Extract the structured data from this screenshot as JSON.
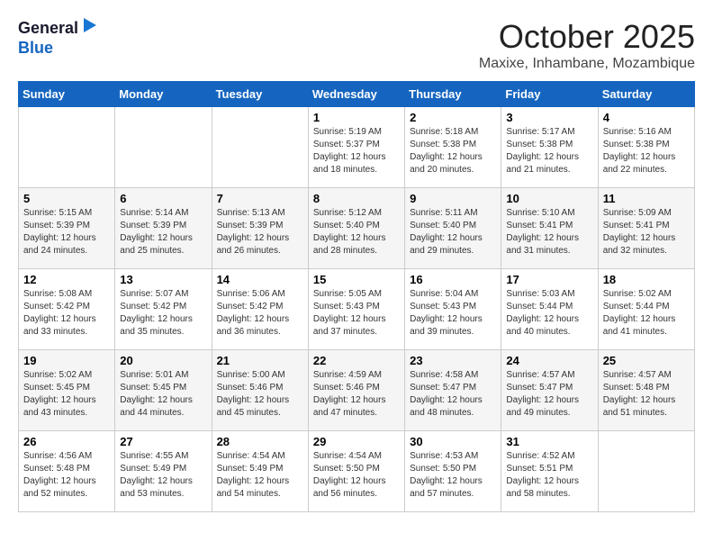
{
  "header": {
    "logo_general": "General",
    "logo_blue": "Blue",
    "month": "October 2025",
    "location": "Maxixe, Inhambane, Mozambique"
  },
  "calendar": {
    "weekdays": [
      "Sunday",
      "Monday",
      "Tuesday",
      "Wednesday",
      "Thursday",
      "Friday",
      "Saturday"
    ],
    "weeks": [
      [
        {
          "day": "",
          "sunrise": "",
          "sunset": "",
          "daylight": ""
        },
        {
          "day": "",
          "sunrise": "",
          "sunset": "",
          "daylight": ""
        },
        {
          "day": "",
          "sunrise": "",
          "sunset": "",
          "daylight": ""
        },
        {
          "day": "1",
          "sunrise": "Sunrise: 5:19 AM",
          "sunset": "Sunset: 5:37 PM",
          "daylight": "Daylight: 12 hours and 18 minutes."
        },
        {
          "day": "2",
          "sunrise": "Sunrise: 5:18 AM",
          "sunset": "Sunset: 5:38 PM",
          "daylight": "Daylight: 12 hours and 20 minutes."
        },
        {
          "day": "3",
          "sunrise": "Sunrise: 5:17 AM",
          "sunset": "Sunset: 5:38 PM",
          "daylight": "Daylight: 12 hours and 21 minutes."
        },
        {
          "day": "4",
          "sunrise": "Sunrise: 5:16 AM",
          "sunset": "Sunset: 5:38 PM",
          "daylight": "Daylight: 12 hours and 22 minutes."
        }
      ],
      [
        {
          "day": "5",
          "sunrise": "Sunrise: 5:15 AM",
          "sunset": "Sunset: 5:39 PM",
          "daylight": "Daylight: 12 hours and 24 minutes."
        },
        {
          "day": "6",
          "sunrise": "Sunrise: 5:14 AM",
          "sunset": "Sunset: 5:39 PM",
          "daylight": "Daylight: 12 hours and 25 minutes."
        },
        {
          "day": "7",
          "sunrise": "Sunrise: 5:13 AM",
          "sunset": "Sunset: 5:39 PM",
          "daylight": "Daylight: 12 hours and 26 minutes."
        },
        {
          "day": "8",
          "sunrise": "Sunrise: 5:12 AM",
          "sunset": "Sunset: 5:40 PM",
          "daylight": "Daylight: 12 hours and 28 minutes."
        },
        {
          "day": "9",
          "sunrise": "Sunrise: 5:11 AM",
          "sunset": "Sunset: 5:40 PM",
          "daylight": "Daylight: 12 hours and 29 minutes."
        },
        {
          "day": "10",
          "sunrise": "Sunrise: 5:10 AM",
          "sunset": "Sunset: 5:41 PM",
          "daylight": "Daylight: 12 hours and 31 minutes."
        },
        {
          "day": "11",
          "sunrise": "Sunrise: 5:09 AM",
          "sunset": "Sunset: 5:41 PM",
          "daylight": "Daylight: 12 hours and 32 minutes."
        }
      ],
      [
        {
          "day": "12",
          "sunrise": "Sunrise: 5:08 AM",
          "sunset": "Sunset: 5:42 PM",
          "daylight": "Daylight: 12 hours and 33 minutes."
        },
        {
          "day": "13",
          "sunrise": "Sunrise: 5:07 AM",
          "sunset": "Sunset: 5:42 PM",
          "daylight": "Daylight: 12 hours and 35 minutes."
        },
        {
          "day": "14",
          "sunrise": "Sunrise: 5:06 AM",
          "sunset": "Sunset: 5:42 PM",
          "daylight": "Daylight: 12 hours and 36 minutes."
        },
        {
          "day": "15",
          "sunrise": "Sunrise: 5:05 AM",
          "sunset": "Sunset: 5:43 PM",
          "daylight": "Daylight: 12 hours and 37 minutes."
        },
        {
          "day": "16",
          "sunrise": "Sunrise: 5:04 AM",
          "sunset": "Sunset: 5:43 PM",
          "daylight": "Daylight: 12 hours and 39 minutes."
        },
        {
          "day": "17",
          "sunrise": "Sunrise: 5:03 AM",
          "sunset": "Sunset: 5:44 PM",
          "daylight": "Daylight: 12 hours and 40 minutes."
        },
        {
          "day": "18",
          "sunrise": "Sunrise: 5:02 AM",
          "sunset": "Sunset: 5:44 PM",
          "daylight": "Daylight: 12 hours and 41 minutes."
        }
      ],
      [
        {
          "day": "19",
          "sunrise": "Sunrise: 5:02 AM",
          "sunset": "Sunset: 5:45 PM",
          "daylight": "Daylight: 12 hours and 43 minutes."
        },
        {
          "day": "20",
          "sunrise": "Sunrise: 5:01 AM",
          "sunset": "Sunset: 5:45 PM",
          "daylight": "Daylight: 12 hours and 44 minutes."
        },
        {
          "day": "21",
          "sunrise": "Sunrise: 5:00 AM",
          "sunset": "Sunset: 5:46 PM",
          "daylight": "Daylight: 12 hours and 45 minutes."
        },
        {
          "day": "22",
          "sunrise": "Sunrise: 4:59 AM",
          "sunset": "Sunset: 5:46 PM",
          "daylight": "Daylight: 12 hours and 47 minutes."
        },
        {
          "day": "23",
          "sunrise": "Sunrise: 4:58 AM",
          "sunset": "Sunset: 5:47 PM",
          "daylight": "Daylight: 12 hours and 48 minutes."
        },
        {
          "day": "24",
          "sunrise": "Sunrise: 4:57 AM",
          "sunset": "Sunset: 5:47 PM",
          "daylight": "Daylight: 12 hours and 49 minutes."
        },
        {
          "day": "25",
          "sunrise": "Sunrise: 4:57 AM",
          "sunset": "Sunset: 5:48 PM",
          "daylight": "Daylight: 12 hours and 51 minutes."
        }
      ],
      [
        {
          "day": "26",
          "sunrise": "Sunrise: 4:56 AM",
          "sunset": "Sunset: 5:48 PM",
          "daylight": "Daylight: 12 hours and 52 minutes."
        },
        {
          "day": "27",
          "sunrise": "Sunrise: 4:55 AM",
          "sunset": "Sunset: 5:49 PM",
          "daylight": "Daylight: 12 hours and 53 minutes."
        },
        {
          "day": "28",
          "sunrise": "Sunrise: 4:54 AM",
          "sunset": "Sunset: 5:49 PM",
          "daylight": "Daylight: 12 hours and 54 minutes."
        },
        {
          "day": "29",
          "sunrise": "Sunrise: 4:54 AM",
          "sunset": "Sunset: 5:50 PM",
          "daylight": "Daylight: 12 hours and 56 minutes."
        },
        {
          "day": "30",
          "sunrise": "Sunrise: 4:53 AM",
          "sunset": "Sunset: 5:50 PM",
          "daylight": "Daylight: 12 hours and 57 minutes."
        },
        {
          "day": "31",
          "sunrise": "Sunrise: 4:52 AM",
          "sunset": "Sunset: 5:51 PM",
          "daylight": "Daylight: 12 hours and 58 minutes."
        },
        {
          "day": "",
          "sunrise": "",
          "sunset": "",
          "daylight": ""
        }
      ]
    ]
  }
}
